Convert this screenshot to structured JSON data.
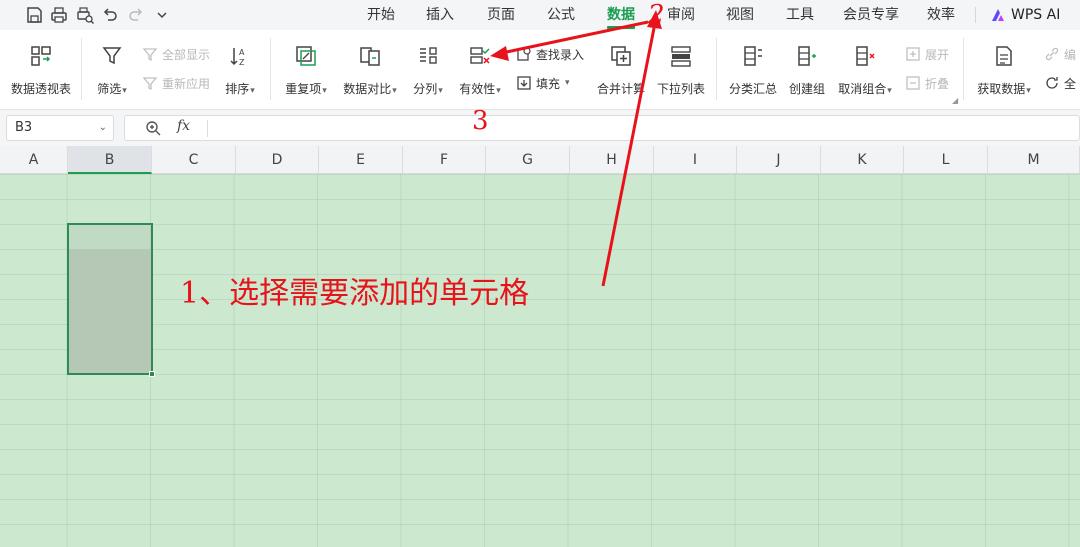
{
  "quick_access": {
    "icons": [
      "save-icon",
      "print-icon",
      "print-preview-icon",
      "undo-icon",
      "redo-icon",
      "chevron-down-icon"
    ]
  },
  "menu": {
    "tabs": [
      "开始",
      "插入",
      "页面",
      "公式",
      "数据",
      "审阅",
      "视图",
      "工具",
      "会员专享",
      "效率"
    ],
    "active_tab": "数据",
    "ai_label": "WPS AI"
  },
  "ribbon": {
    "pivot_table": "数据透视表",
    "filter": "筛选",
    "show_all": "全部显示",
    "reapply": "重新应用",
    "sort": "排序",
    "duplicates": "重复项",
    "compare": "数据对比",
    "split": "分列",
    "validation": "有效性",
    "lookup_entry": "查找录入",
    "fill": "填充",
    "consolidate": "合并计算",
    "dropdown_list": "下拉列表",
    "subtotal": "分类汇总",
    "group": "创建组",
    "ungroup": "取消组合",
    "expand": "展开",
    "collapse": "折叠",
    "get_data": "获取数据",
    "edit_links": "编",
    "refresh_all": "全"
  },
  "formula_bar": {
    "name_box": "B3",
    "fx": "fx",
    "formula": ""
  },
  "columns": [
    "A",
    "B",
    "C",
    "D",
    "E",
    "F",
    "G",
    "H",
    "I",
    "J",
    "K",
    "L",
    "M"
  ],
  "selected_column": "B",
  "annotations": {
    "step1": "1、选择需要添加的单元格",
    "step2": "2",
    "step3": "3"
  },
  "colors": {
    "accent": "#1a9e52",
    "grid_background": "#cce8cf",
    "annotation": "#e8121b"
  }
}
